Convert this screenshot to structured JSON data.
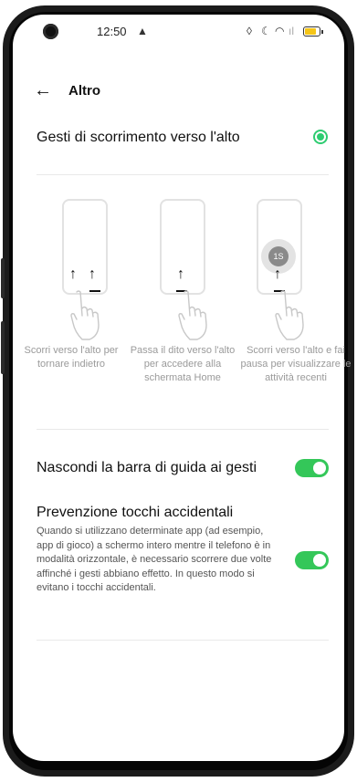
{
  "status_bar": {
    "time": "12:50",
    "icons": [
      "camera-cutout",
      "alert-icon",
      "alarm-icon",
      "moon-icon",
      "wifi-icon",
      "signal-icon",
      "battery-icon"
    ]
  },
  "header": {
    "back_icon": "arrow-left-icon",
    "title": "Altro"
  },
  "gestures": {
    "label": "Gesti di scorrimento verso l'alto",
    "selected": true,
    "illustrations": [
      {
        "caption": "Scorri verso l'alto per tornare indietro"
      },
      {
        "caption": "Passa il dito verso l'alto per accedere alla schermata Home"
      },
      {
        "caption": "Scorri verso l'alto e fai pausa per visualizzare le attività recenti",
        "timer_label": "1S"
      }
    ]
  },
  "hide_gesture_bar": {
    "label": "Nascondi la barra di guida ai gesti",
    "enabled": true
  },
  "accidental_touch": {
    "label": "Prevenzione tocchi accidentali",
    "description": "Quando si utilizzano determinate app (ad esempio, app di gioco) a schermo intero mentre il telefono è in modalità orizzontale, è necessario scorrere due volte affinché i gesti abbiano effetto. In questo modo si evitano i tocchi accidentali.",
    "enabled": true
  },
  "colors": {
    "accent_green": "#34c759",
    "battery_yellow": "#f5c518"
  }
}
